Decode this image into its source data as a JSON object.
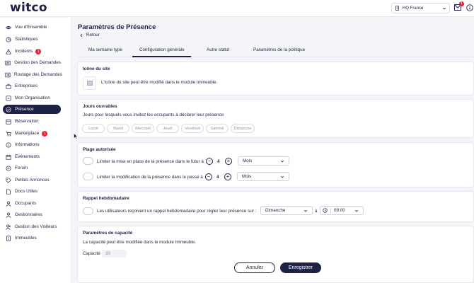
{
  "header": {
    "logo": "witco",
    "site_selector": "HQ France",
    "mail_badge": "1"
  },
  "sidebar": {
    "items": [
      {
        "label": "Vue d'Ensemble",
        "icon": "eye-icon"
      },
      {
        "label": "Statistiques",
        "icon": "stats-icon"
      },
      {
        "label": "Incidents",
        "icon": "warning-icon",
        "badge": "1"
      },
      {
        "label": "Gestion des Demandes",
        "icon": "requests-icon"
      },
      {
        "label": "Routage des Demandes",
        "icon": "routing-icon"
      },
      {
        "label": "Entreprises",
        "icon": "company-icon"
      },
      {
        "label": "Mon Organisation",
        "icon": "organization-icon"
      },
      {
        "label": "Présence",
        "icon": "presence-icon",
        "active": true
      },
      {
        "label": "Réservation",
        "icon": "reservation-icon"
      },
      {
        "label": "Marketplace",
        "icon": "cart-icon",
        "badge": "1"
      },
      {
        "label": "Informations",
        "icon": "info-icon"
      },
      {
        "label": "Evénements",
        "icon": "calendar-icon"
      },
      {
        "label": "Forum",
        "icon": "forum-icon"
      },
      {
        "label": "Petites Annonces",
        "icon": "tag-icon"
      },
      {
        "label": "Docs Utiles",
        "icon": "docs-icon"
      },
      {
        "label": "Occupants",
        "icon": "users-icon"
      },
      {
        "label": "Gestionnaires",
        "icon": "managers-icon"
      },
      {
        "label": "Gestion des Visiteurs",
        "icon": "visitors-icon"
      },
      {
        "label": "Immeubles",
        "icon": "building-icon"
      }
    ]
  },
  "page": {
    "title": "Paramètres de Présence",
    "back_label": "Retour",
    "tabs": [
      "Ma semaine type",
      "Configuration générale",
      "Autre statut",
      "Paramètres de la politique"
    ],
    "active_tab": "Configuration générale"
  },
  "site_icon": {
    "title": "Icône du site",
    "description": "L'icône du site peut être modifié dans le module Immeuble."
  },
  "working_days": {
    "title": "Jours ouvrables",
    "description": "Jours pour lesquels vous invitez les occupants à déclarer leur présence",
    "days": [
      "Lundi",
      "Mardi",
      "Mercredi",
      "Jeudi",
      "Vendredi",
      "Samedi",
      "Dimanche"
    ]
  },
  "allowed_range": {
    "title": "Plage autorisée",
    "future": {
      "label": "Limiter la mise en place de la présence dans le futur à",
      "value": "4",
      "unit": "Mois"
    },
    "past": {
      "label": "Limiter la modification de la présence dans le passé à",
      "value": "4",
      "unit": "Mois"
    }
  },
  "weekly_reminder": {
    "title": "Rappel hebdomadaire",
    "label": "Les utilisateurs reçoivent un rappel hebdomadaire pour régler leur présence sur :",
    "day": "Dimanche",
    "at": "à",
    "time": "09:00"
  },
  "capacity": {
    "title": "Paramètres de capacité",
    "description": "La capacité peut être modifiée dans le module Immeuble.",
    "label": "Capacité",
    "value": "30"
  },
  "footer": {
    "cancel": "Annuler",
    "save": "Enregistrer"
  },
  "colors": {
    "primary": "#1d2146",
    "badge": "#e8233a",
    "background": "#f4f5f9"
  }
}
